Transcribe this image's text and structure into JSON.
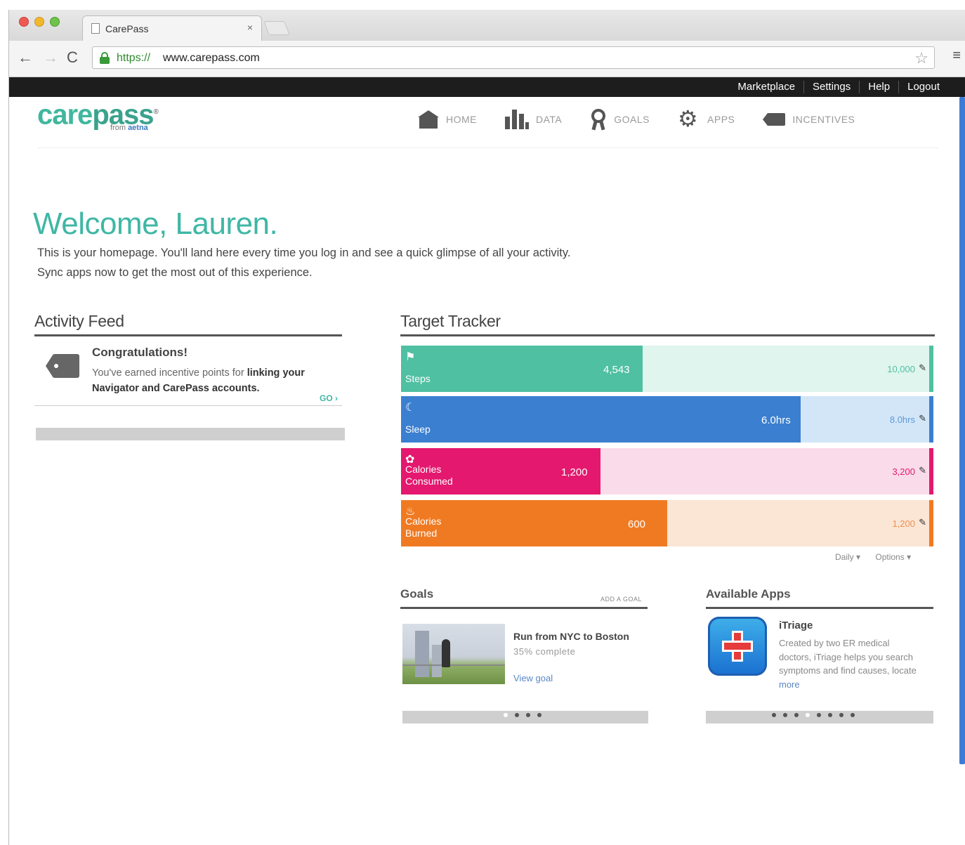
{
  "browser": {
    "tab_title": "CarePass",
    "tab_close": "×",
    "url_scheme": "https://",
    "url_rest": "www.carepass.com",
    "back_glyph": "←",
    "forward_glyph": "→",
    "reload_glyph": "C",
    "star_glyph": "☆",
    "menu_glyph": "≡"
  },
  "topbar": {
    "links": [
      "Marketplace",
      "Settings",
      "Help",
      "Logout"
    ]
  },
  "logo": {
    "care": "care",
    "pass": "pass",
    "trademark": "®",
    "sub_from": "from",
    "sub_brand": "aetna"
  },
  "nav": {
    "home": "HOME",
    "data": "DATA",
    "goals": "GOALS",
    "apps": "APPS",
    "incentives": "INCENTIVES"
  },
  "welcome": {
    "title": "Welcome, Lauren.",
    "line1": "This is your homepage.  You'll land here every time you log in and see a quick glimpse of all your activity.",
    "line2": "Sync apps now to get the most out of this experience."
  },
  "activity_feed": {
    "title": "Activity Feed",
    "item_title": "Congratulations!",
    "item_text": "You've earned incentive points for ",
    "item_bold": "linking your Navigator and CarePass accounts.",
    "go": "GO ›"
  },
  "target_tracker": {
    "title": "Target Tracker",
    "bars": [
      {
        "label": "Steps",
        "value": "4,543",
        "target": "10,000",
        "fraction": 0.454,
        "fill": "#4fc0a2",
        "track": "#dff5ee",
        "cap": "#4fc0a2",
        "target_color": "#4fc0a2",
        "icon": "⚑"
      },
      {
        "label": "Sleep",
        "value": "6.0hrs",
        "target": "8.0hrs",
        "fraction": 0.75,
        "fill": "#3b7fd0",
        "track": "#d3e6f8",
        "cap": "#3b7fd0",
        "target_color": "#5b9ad8",
        "icon": "☾"
      },
      {
        "label": "Calories Consumed",
        "value": "1,200",
        "target": "3,200",
        "fraction": 0.375,
        "fill": "#e3186e",
        "track": "#fadbea",
        "cap": "#e3186e",
        "target_color": "#e3186e",
        "icon": "✿"
      },
      {
        "label": "Calories Burned",
        "value": "600",
        "target": "1,200",
        "fraction": 0.5,
        "fill": "#f07a22",
        "track": "#fbe5d5",
        "cap": "#f07a22",
        "target_color": "#f09050",
        "icon": "♨"
      }
    ],
    "edit_glyph": "✎",
    "period": "Daily ▾",
    "options": "Options ▾"
  },
  "goals": {
    "title": "Goals",
    "add_label": "ADD A GOAL",
    "item_title": "Run from NYC to Boston",
    "item_progress": "35% complete",
    "item_link": "View goal"
  },
  "apps": {
    "title": "Available Apps",
    "app_name": "iTriage",
    "app_desc": "Created by two ER medical doctors, iTriage helps you search symptoms and find causes, locate ",
    "more": "more"
  }
}
